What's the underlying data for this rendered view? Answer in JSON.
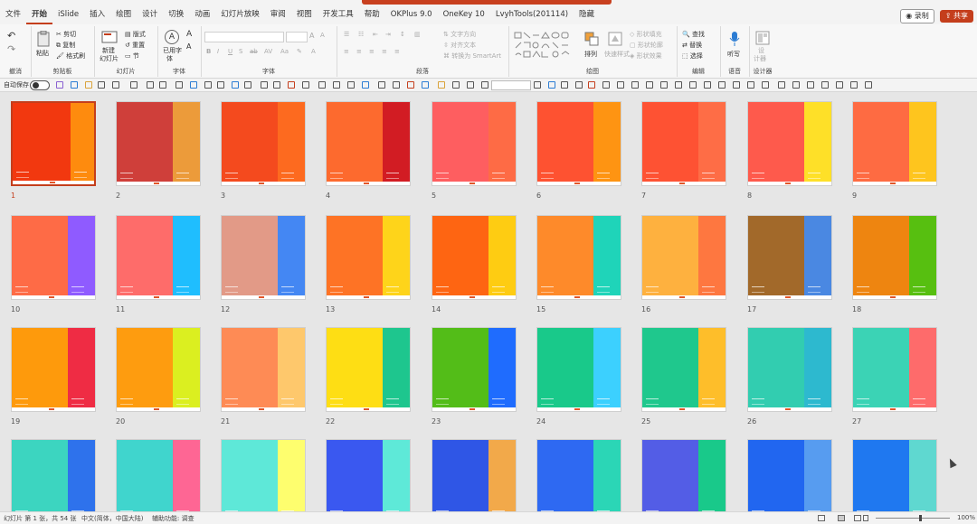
{
  "menu": {
    "tabs": [
      "文件",
      "开始",
      "iSlide",
      "插入",
      "绘图",
      "设计",
      "切换",
      "动画",
      "幻灯片放映",
      "审阅",
      "视图",
      "开发工具",
      "帮助",
      "OKPlus 9.0",
      "OneKey 10",
      "LvyhTools(201114)",
      "隐藏"
    ],
    "active": "开始",
    "record_label": "录制",
    "share_label": "共享"
  },
  "ribbon": {
    "groups": {
      "undo": "撤消",
      "clipboard": "剪贴板",
      "slides": "幻灯片",
      "font2": "字体",
      "font": "字体",
      "paragraph": "段落",
      "drawing": "绘图",
      "editing": "编辑",
      "voice": "语音",
      "designer": "设计器"
    },
    "clipboard": {
      "paste": "粘贴",
      "cut": "剪切",
      "copy": "复制",
      "format_painter": "格式刷"
    },
    "slides": {
      "new_slide": "新建",
      "new_slide2": "幻灯片",
      "layout": "版式",
      "reset": "重置",
      "section": "节"
    },
    "font2": {
      "used_font": "已用字",
      "used_font2": "体"
    },
    "paragraph": {
      "text_direction": "文字方向",
      "align_text": "对齐文本",
      "smartart": "转换为 SmartArt"
    },
    "drawing": {
      "arrange": "排列",
      "quick_styles": "快速样式",
      "shape_fill": "形状填充",
      "shape_outline": "形状轮廓",
      "shape_effects": "形状效果"
    },
    "editing": {
      "find": "查找",
      "replace": "替换",
      "select": "选择"
    },
    "voice": {
      "dictate": "听写"
    },
    "designer": {
      "design": "设",
      "ideas": "计器"
    }
  },
  "qat": {
    "autosave_label": "自动保存",
    "zoom_value": ""
  },
  "slides": [
    {
      "num": "1",
      "left": "#f2380f",
      "right": "#fe8b0e",
      "ratio": 0.68,
      "selected": true
    },
    {
      "num": "2",
      "left": "#cf3f3a",
      "right": "#ec9b3a",
      "ratio": 0.66
    },
    {
      "num": "3",
      "left": "#f44a1e",
      "right": "#fd6a1f",
      "ratio": 0.66
    },
    {
      "num": "4",
      "left": "#fd6a2e",
      "right": "#d21c23",
      "ratio": 0.66
    },
    {
      "num": "5",
      "left": "#fe5e60",
      "right": "#fe6b45",
      "ratio": 0.66
    },
    {
      "num": "6",
      "left": "#fe5231",
      "right": "#fe9412",
      "ratio": 0.66
    },
    {
      "num": "7",
      "left": "#fe5233",
      "right": "#fe6d46",
      "ratio": 0.66
    },
    {
      "num": "8",
      "left": "#fe5a4c",
      "right": "#fee028",
      "ratio": 0.66
    },
    {
      "num": "9",
      "left": "#fe6b42",
      "right": "#fec51e",
      "ratio": 0.66
    },
    {
      "num": "10",
      "left": "#fe6b46",
      "right": "#8f5bff",
      "ratio": 0.66
    },
    {
      "num": "11",
      "left": "#fe6c6a",
      "right": "#1fbefe",
      "ratio": 0.66
    },
    {
      "num": "12",
      "left": "#e29a87",
      "right": "#4487f3",
      "ratio": 0.66
    },
    {
      "num": "13",
      "left": "#fe7325",
      "right": "#fed41a",
      "ratio": 0.66
    },
    {
      "num": "14",
      "left": "#fe6512",
      "right": "#fecc12",
      "ratio": 0.66
    },
    {
      "num": "15",
      "left": "#fe8a2a",
      "right": "#1fd4b9",
      "ratio": 0.66
    },
    {
      "num": "16",
      "left": "#feb13f",
      "right": "#fe7740",
      "ratio": 0.66
    },
    {
      "num": "17",
      "left": "#a2692a",
      "right": "#4a88e2",
      "ratio": 0.66
    },
    {
      "num": "18",
      "left": "#ee8510",
      "right": "#57bf10",
      "ratio": 0.66
    },
    {
      "num": "19",
      "left": "#fe9a0c",
      "right": "#ef2c44",
      "ratio": 0.66
    },
    {
      "num": "20",
      "left": "#fe9c0f",
      "right": "#dbef20",
      "ratio": 0.66
    },
    {
      "num": "21",
      "left": "#fe8b55",
      "right": "#fec86c",
      "ratio": 0.66
    },
    {
      "num": "22",
      "left": "#fede14",
      "right": "#1ec68e",
      "ratio": 0.66
    },
    {
      "num": "23",
      "left": "#53bd18",
      "right": "#1f6cfe",
      "ratio": 0.66
    },
    {
      "num": "24",
      "left": "#19c98a",
      "right": "#3cd0fe",
      "ratio": 0.66
    },
    {
      "num": "25",
      "left": "#1fc88d",
      "right": "#febe2a",
      "ratio": 0.66
    },
    {
      "num": "26",
      "left": "#32cdb0",
      "right": "#2db9cf",
      "ratio": 0.66
    },
    {
      "num": "27",
      "left": "#3bd3b5",
      "right": "#fe6b6b",
      "ratio": 0.66
    },
    {
      "num": "",
      "left": "#3cd5c0",
      "right": "#2e72ec",
      "ratio": 0.66
    },
    {
      "num": "",
      "left": "#40d5cd",
      "right": "#fe6694",
      "ratio": 0.66
    },
    {
      "num": "",
      "left": "#5ee8d8",
      "right": "#fefe6e",
      "ratio": 0.66
    },
    {
      "num": "",
      "left": "#3a58f0",
      "right": "#5ee9d8",
      "ratio": 0.66
    },
    {
      "num": "",
      "left": "#2f56e6",
      "right": "#f2a94a",
      "ratio": 0.66
    },
    {
      "num": "",
      "left": "#2e69f2",
      "right": "#2bd6b6",
      "ratio": 0.66
    },
    {
      "num": "",
      "left": "#535de6",
      "right": "#19c98a",
      "ratio": 0.66
    },
    {
      "num": "",
      "left": "#2166f0",
      "right": "#579cf0",
      "ratio": 0.66
    },
    {
      "num": "",
      "left": "#1f78f0",
      "right": "#5fd8d0",
      "ratio": 0.66
    }
  ],
  "status": {
    "slide_info": "幻灯片 第 1 张，共 54 张",
    "language": "中文(简体，中国大陆)",
    "accessibility": "辅助功能: 调查",
    "zoom": "100%"
  }
}
